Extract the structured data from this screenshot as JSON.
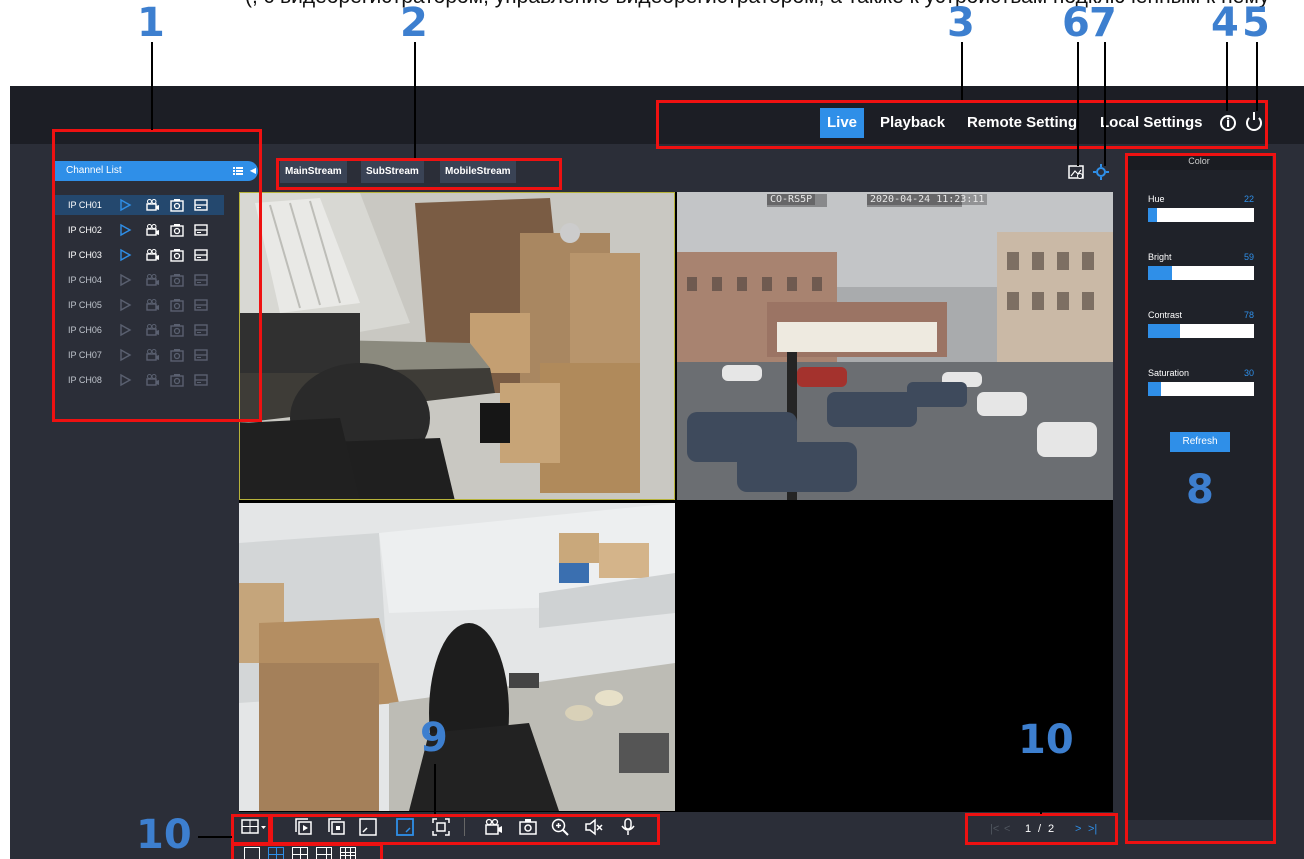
{
  "caption_text": "(, с видеорегистратором, управление видеорегистратором, а также к  устройствам подключенным к нему",
  "callouts": [
    "1",
    "2",
    "3",
    "4",
    "5",
    "6",
    "7",
    "8",
    "9",
    "10",
    "10"
  ],
  "nav": {
    "live": "Live",
    "playback": "Playback",
    "remote": "Remote Setting",
    "local": "Local Settings",
    "active": "Live"
  },
  "channel_list": {
    "title": "Channel List",
    "channels": [
      {
        "name": "IP CH01",
        "online": true,
        "selected": true
      },
      {
        "name": "IP CH02",
        "online": true,
        "selected": false
      },
      {
        "name": "IP CH03",
        "online": true,
        "selected": false
      },
      {
        "name": "IP CH04",
        "online": false,
        "selected": false
      },
      {
        "name": "IP CH05",
        "online": false,
        "selected": false
      },
      {
        "name": "IP CH06",
        "online": false,
        "selected": false
      },
      {
        "name": "IP CH07",
        "online": false,
        "selected": false
      },
      {
        "name": "IP CH08",
        "online": false,
        "selected": false
      }
    ]
  },
  "streams": {
    "main": "MainStream",
    "sub": "SubStream",
    "mobile": "MobileStream"
  },
  "video": {
    "cell2_osd_name": "CO-RS5P",
    "cell2_osd_time": "2020-04-24 11:23:11"
  },
  "color_panel": {
    "title": "Color",
    "sliders": [
      {
        "name": "Hue",
        "value": 22
      },
      {
        "name": "Bright",
        "value": 59
      },
      {
        "name": "Contrast",
        "value": 78
      },
      {
        "name": "Saturation",
        "value": 30
      }
    ],
    "slider_max": 255,
    "refresh": "Refresh"
  },
  "pager": {
    "current": "1",
    "sep": "/",
    "total": "2"
  },
  "colors": {
    "accent": "#2f8fe8",
    "callout": "#3d7fcf",
    "highlight": "#e11111",
    "bg": "#2b2e38",
    "topbar": "#1c1e25"
  },
  "icons": [
    "grid-layout-icon",
    "sequence-play-icon",
    "sequence-stop-icon",
    "aspect-ratio-icon",
    "original-size-icon",
    "fullscreen-icon",
    "record-icon",
    "snapshot-icon",
    "zoom-icon",
    "mute-icon",
    "talk-icon",
    "first-page-icon",
    "prev-page-icon",
    "next-page-icon",
    "last-page-icon",
    "image-settings-icon",
    "color-settings-icon",
    "info-icon",
    "power-icon"
  ]
}
